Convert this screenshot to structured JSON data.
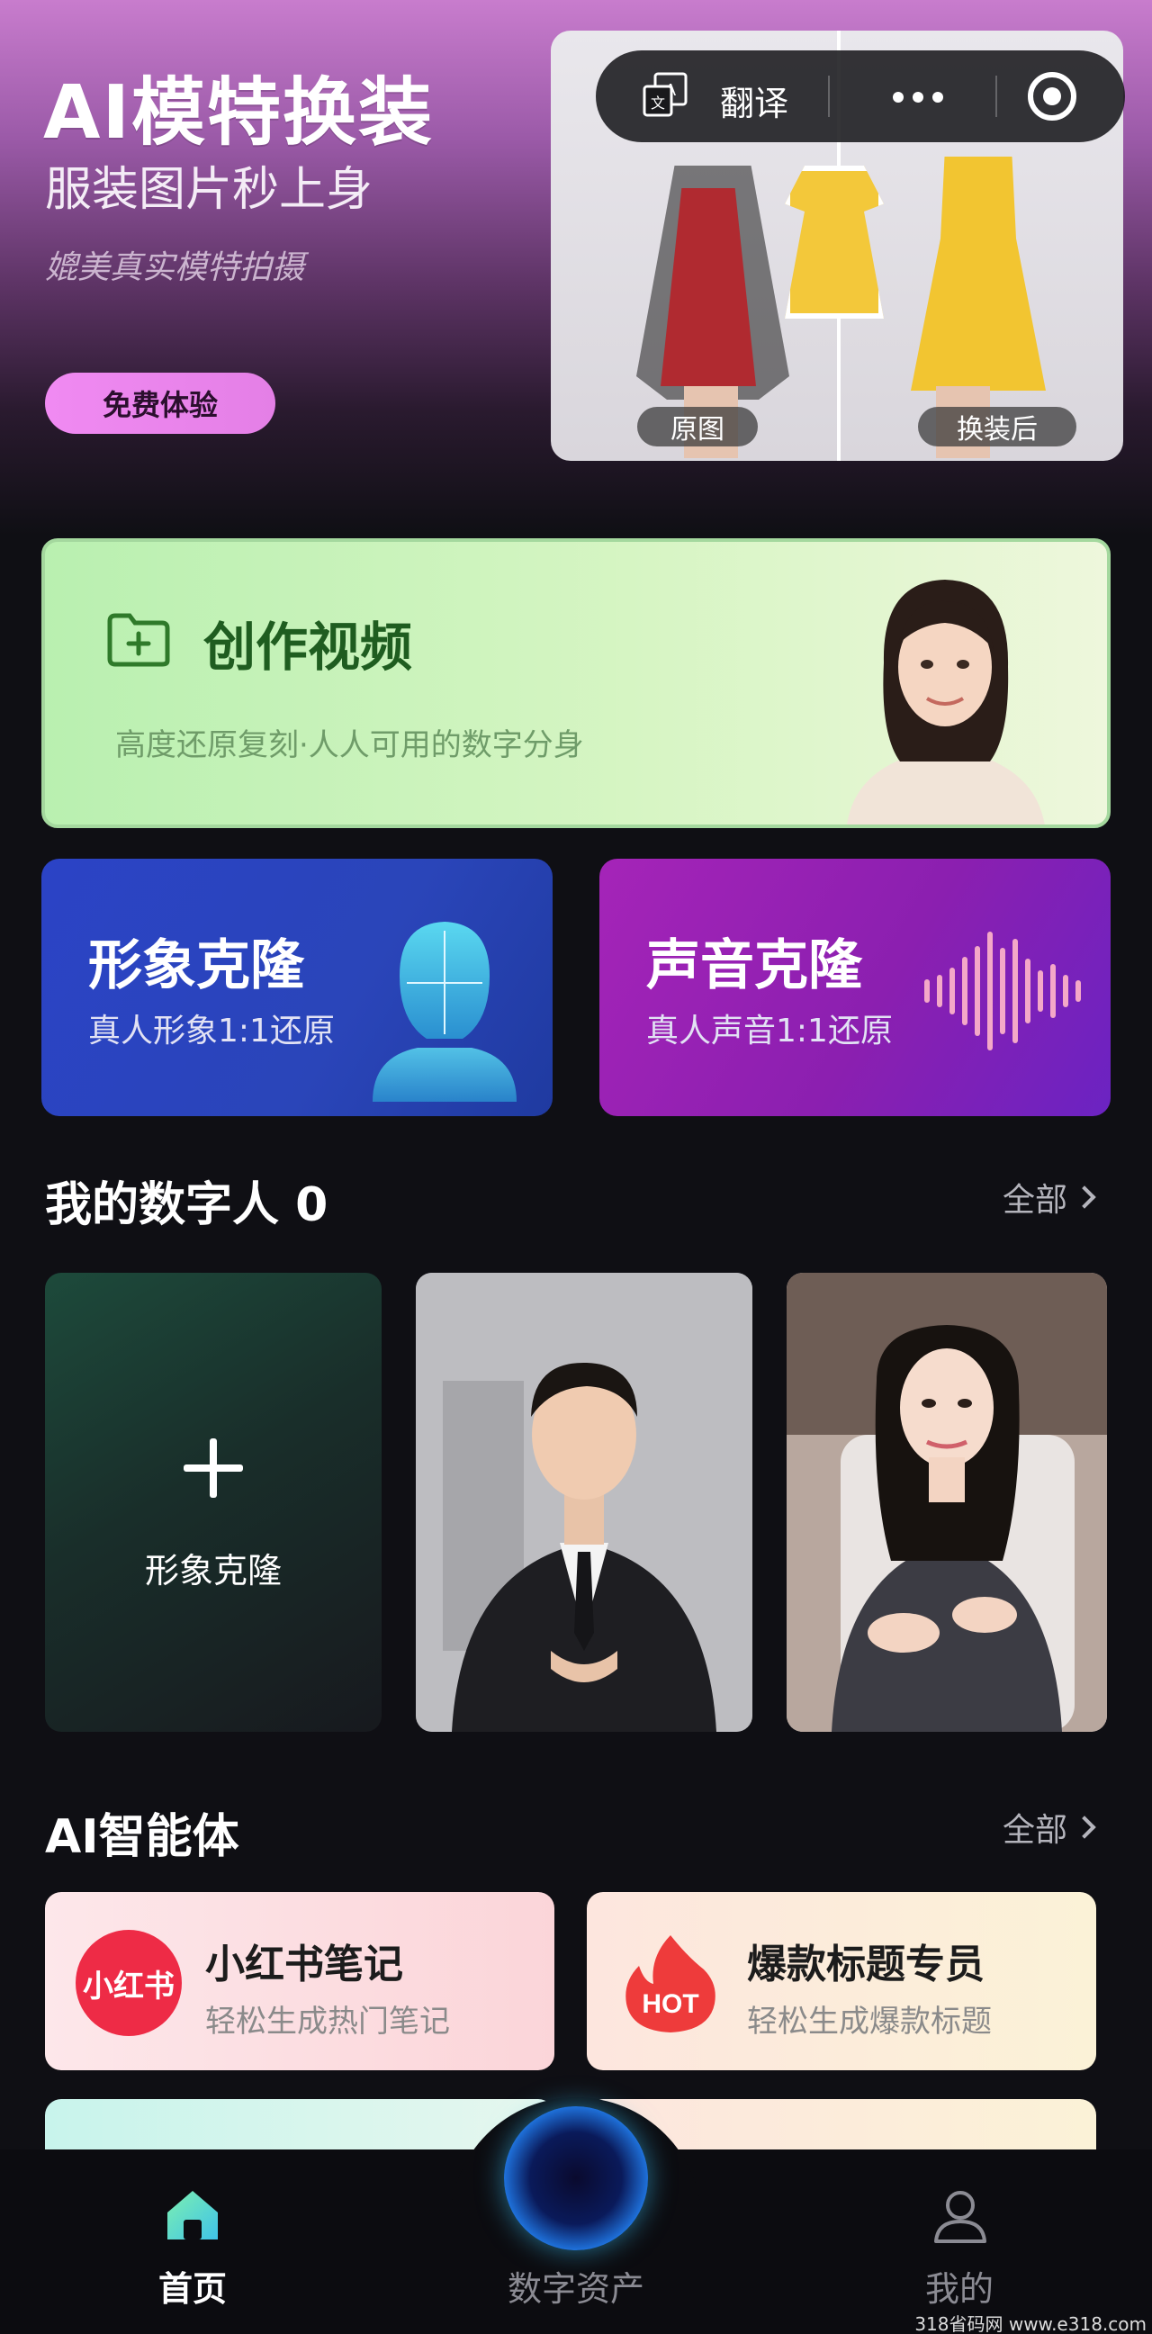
{
  "hero": {
    "title": "AI模特换装",
    "subtitle": "服装图片秒上身",
    "description": "媲美真实模特拍摄",
    "button_label": "免费体验",
    "compare": {
      "before_label": "原图",
      "after_label": "换装后"
    }
  },
  "capsule": {
    "translate_label": "翻译",
    "translate_icon": "translate-icon",
    "more_icon": "more-dots-icon",
    "close_icon": "target-circle-icon"
  },
  "create_video": {
    "title": "创作视频",
    "description": "高度还原复刻·人人可用的数字分身",
    "icon": "folder-plus-icon"
  },
  "clones": [
    {
      "title": "形象克隆",
      "description": "真人形象1:1还原",
      "icon": "head-icon"
    },
    {
      "title": "声音克隆",
      "description": "真人声音1:1还原",
      "icon": "sound-wave-icon"
    }
  ],
  "digital_humans": {
    "title": "我的数字人 0",
    "more_label": "全部",
    "add_label": "形象克隆"
  },
  "agents": {
    "title": "AI智能体",
    "more_label": "全部",
    "items": [
      {
        "logo_text": "小红书",
        "title": "小红书笔记",
        "description": "轻松生成热门笔记"
      },
      {
        "logo_text": "HOT",
        "title": "爆款标题专员",
        "description": "轻松生成爆款标题"
      }
    ]
  },
  "nav": {
    "items": [
      {
        "label": "首页",
        "icon": "home-icon",
        "active": true
      },
      {
        "label": "数字资产",
        "icon": "orb-icon",
        "active": false
      },
      {
        "label": "我的",
        "icon": "user-icon",
        "active": false
      }
    ]
  },
  "watermark": "318省码网 www.e318.com",
  "colors": {
    "accent_pink": "#e47fe6",
    "create_green": "#1f5d20",
    "clone_blue": "#2b43c6",
    "clone_purple": "#a524b8",
    "xhs_red": "#ee2b46"
  }
}
